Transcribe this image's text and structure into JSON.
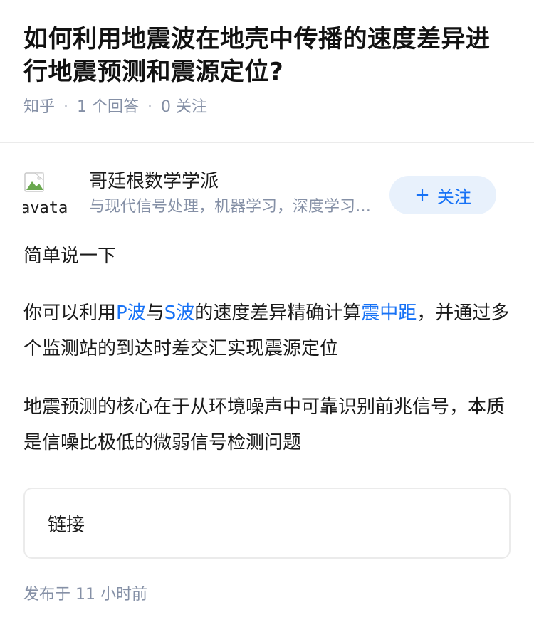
{
  "question": {
    "title": "如何利用地震波在地壳中传播的速度差异进行地震预测和震源定位?",
    "source": "知乎",
    "answers": "1 个回答",
    "followers": "0 关注"
  },
  "author": {
    "avatar_alt": "avatar",
    "name": "哥廷根数学学派",
    "bio": "与现代信号处理，机器学习，深度学习，故障诊断等",
    "follow_icon": "+",
    "follow_label": "关注"
  },
  "answer": {
    "para1": "简单说一下",
    "para2": {
      "t1": "你可以利用",
      "link1": "P波",
      "t2": "与",
      "link2": "S波",
      "t3": "的速度差异精确计算",
      "link3": "震中距",
      "t4": "，并通过多个监测站的到达时差交汇实现震源定位"
    },
    "para3": "地震预测的核心在于从环境噪声中可靠识别前兆信号，本质是信噪比极低的微弱信号检测问题",
    "link_card": "链接",
    "publish_time": "发布于 11 小时前"
  },
  "colors": {
    "link": "#1772f6",
    "meta": "#8590a6",
    "follow_bg": "#e8f1fc"
  }
}
